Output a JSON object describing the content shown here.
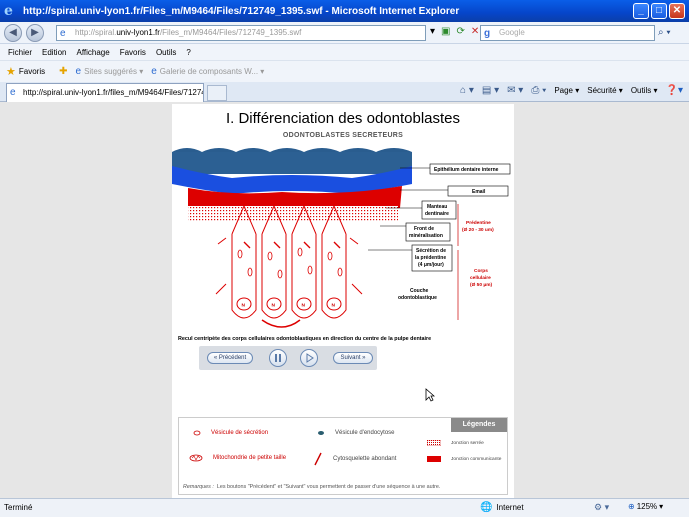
{
  "window": {
    "title": "http://spiral.univ-lyon1.fr/Files_m/M9464/Files/712749_1395.swf - Microsoft Internet Explorer",
    "minimize": "_",
    "maximize": "□",
    "close": "✕"
  },
  "address_bar": {
    "url_prefix": "http://spiral.",
    "url_host": "univ-lyon1.fr",
    "url_rest": "/Files_m/M9464/Files/712749_1395.swf",
    "search_placeholder": "Google"
  },
  "menu": [
    "Fichier",
    "Edition",
    "Affichage",
    "Favoris",
    "Outils",
    "?"
  ],
  "favorites_bar": {
    "label": "Favoris",
    "items": [
      "Sites suggérés ▾",
      "Galerie de composants W... ▾"
    ]
  },
  "tab": {
    "label": "http://spiral.univ-lyon1.fr/files_m/M9464/Files/71274..."
  },
  "command_bar": {
    "page": "Page ▾",
    "security": "Sécurité ▾",
    "tools": "Outils ▾"
  },
  "slide": {
    "title": "I. Différenciation des odontoblastes",
    "subtitle": "ODONTOBLASTES SECRETEURS",
    "labels": {
      "epithelium": "Epithélium dentaire interne",
      "email": "Email",
      "manteau_1": "Manteau",
      "manteau_2": "dentinaire",
      "front_1": "Front de",
      "front_2": "minéralisation",
      "secretion_1": "Sécrétion de",
      "secretion_2": "la prédentine",
      "secretion_3": "(4 μm/jour)",
      "couche_1": "Couche",
      "couche_2": "odontoblastique",
      "predentine_1": "Prédentine",
      "predentine_2": "(Ø 20 - 30 um)",
      "corps_1": "Corps",
      "corps_2": "cellulaire",
      "corps_3": "(Ø 50 μm)",
      "nucleus": "N"
    },
    "caption": "Recul centripète des corps cellulaires odontoblastiques en direction du centre de la pulpe dentaire",
    "controls": {
      "prev": "« Précédent",
      "next": "Suivant »"
    },
    "legend": {
      "header": "Légendes",
      "vesicule_secretion": "Vésicule de sécrétion",
      "vesicule_endocytose": "Vésicule d'endocytose",
      "mitochondrie": "Mitochondrie de petite taille",
      "cytosquelette": "Cytosquelette abondant",
      "jonction_serree": "Jonction serrée",
      "jonction_communicante": "Jonction communicante",
      "remark_label": "Remarques :",
      "remark_text": "Les boutons \"Précédent\" et \"Suivant\" vous permettent de passer d'une séquence à une autre."
    },
    "colors": {
      "red": "#dd0000",
      "blue": "#1a4fe0",
      "epithelium": "#2a5d8f"
    }
  },
  "status_bar": {
    "text": "Terminé",
    "zone": "Internet",
    "zoom": "125%"
  }
}
